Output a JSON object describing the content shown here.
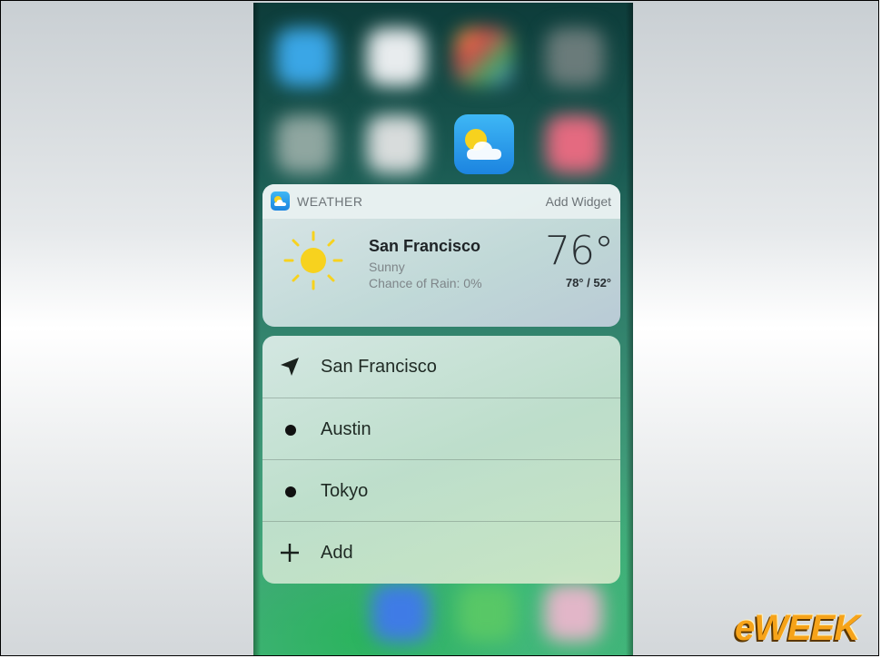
{
  "widget": {
    "app_name": "WEATHER",
    "add_widget_label": "Add Widget",
    "city": "San Francisco",
    "condition": "Sunny",
    "chance_of_rain": "Chance of Rain: 0%",
    "temperature": "76°",
    "high_low": "78° / 52°"
  },
  "quick_actions": [
    {
      "label": "San Francisco",
      "icon": "location-arrow-icon"
    },
    {
      "label": "Austin",
      "icon": "dot-icon"
    },
    {
      "label": "Tokyo",
      "icon": "dot-icon"
    },
    {
      "label": "Add",
      "icon": "plus-icon"
    }
  ],
  "watermark": {
    "text": "eWEEK"
  },
  "colors": {
    "sun": "#f7d21e",
    "weather_icon_blue": "#1c84e0"
  }
}
